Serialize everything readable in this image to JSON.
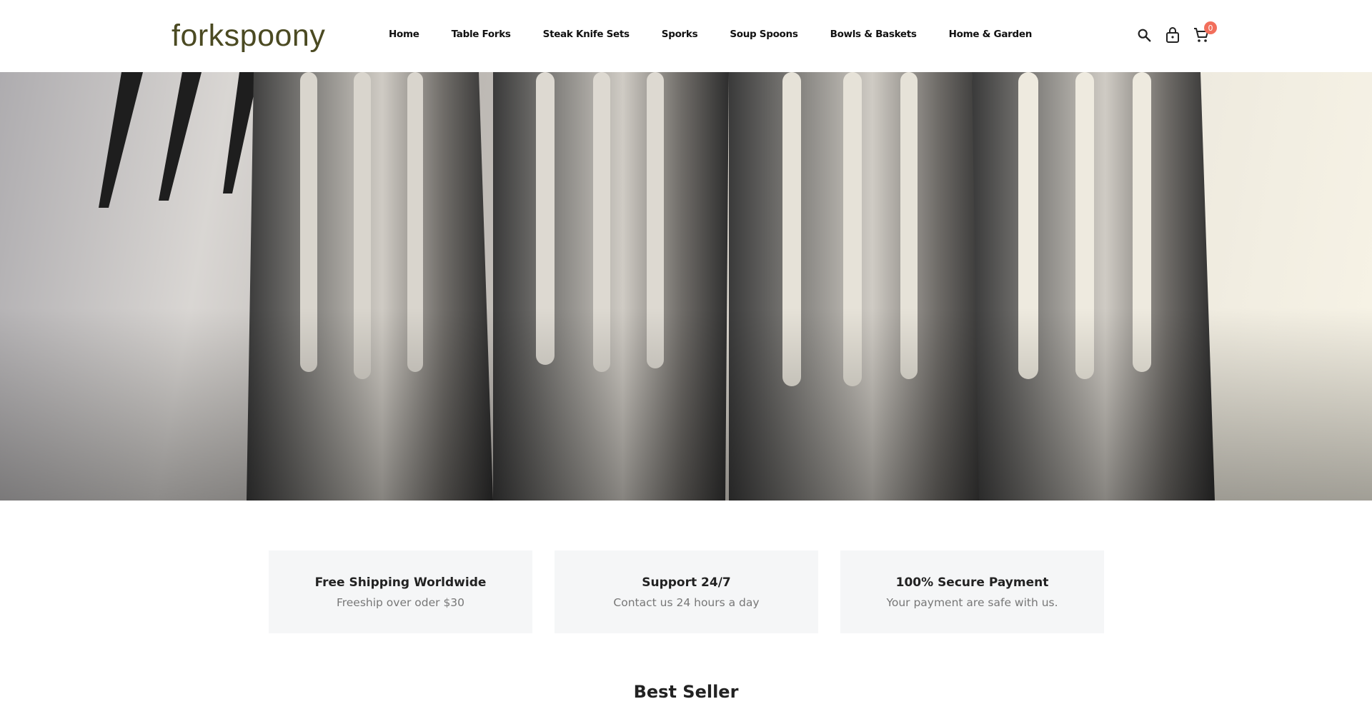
{
  "header": {
    "logo": "forkspoony",
    "nav": [
      {
        "label": "Home"
      },
      {
        "label": "Table Forks"
      },
      {
        "label": "Steak Knife Sets"
      },
      {
        "label": "Sporks"
      },
      {
        "label": "Soup Spoons"
      },
      {
        "label": "Bowls & Baskets"
      },
      {
        "label": "Home & Garden"
      }
    ],
    "icons": [
      "search-icon",
      "lock-bag-icon",
      "cart-icon"
    ],
    "cart_count": "0"
  },
  "features": [
    {
      "title": "Free Shipping Worldwide",
      "subtitle": "Freeship over oder $30"
    },
    {
      "title": "Support 24/7",
      "subtitle": "Contact us 24 hours a day"
    },
    {
      "title": "100% Secure Payment",
      "subtitle": "Your payment are safe with us."
    }
  ],
  "best_seller": {
    "title": "Best Seller"
  },
  "colors": {
    "logo": "#4b4a22",
    "badge": "#f26f5c",
    "feature_bg": "#f5f6f7"
  }
}
